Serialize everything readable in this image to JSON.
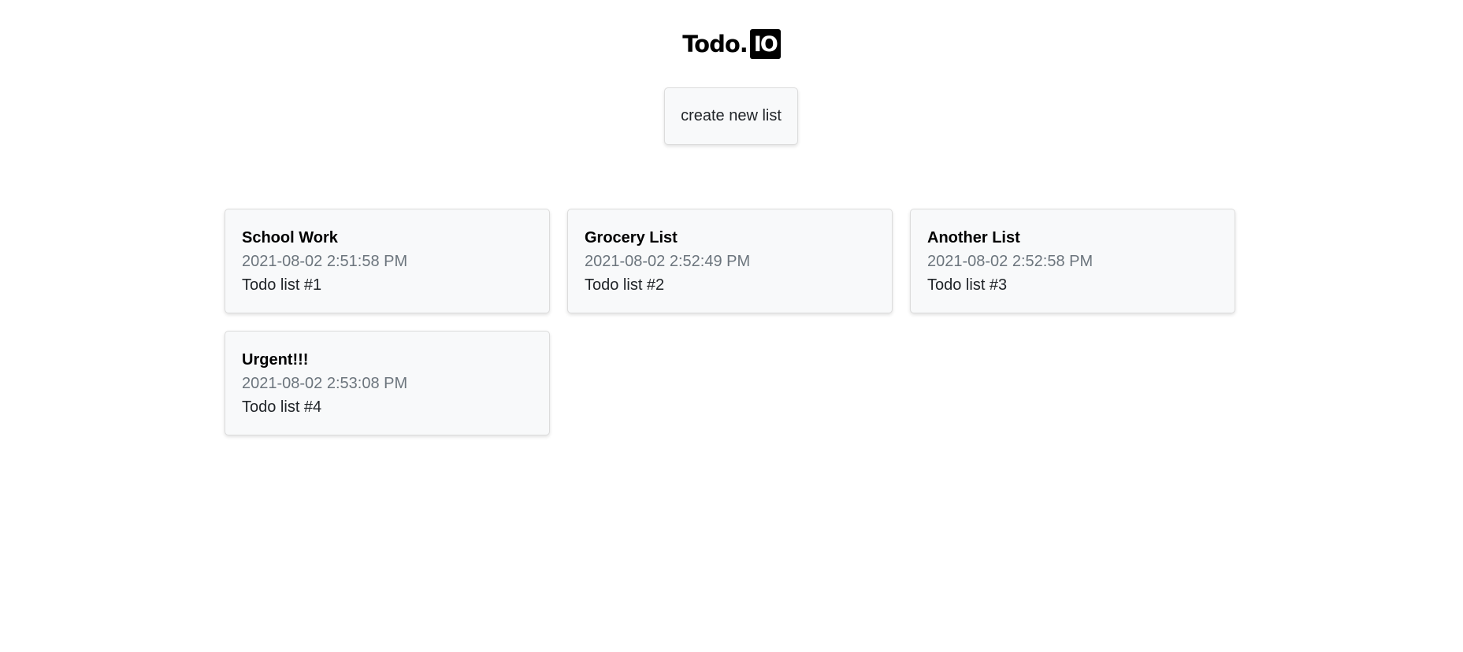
{
  "header": {
    "logo_text": "Todo.",
    "logo_badge": "IO"
  },
  "create_button": {
    "label": "create new list"
  },
  "lists": [
    {
      "title": "School Work",
      "date": "2021-08-02 2:51:58 PM",
      "subtitle": "Todo list #1"
    },
    {
      "title": "Grocery List",
      "date": "2021-08-02 2:52:49 PM",
      "subtitle": "Todo list #2"
    },
    {
      "title": "Another List",
      "date": "2021-08-02 2:52:58 PM",
      "subtitle": "Todo list #3"
    },
    {
      "title": "Urgent!!!",
      "date": "2021-08-02 2:53:08 PM",
      "subtitle": "Todo list #4"
    }
  ]
}
